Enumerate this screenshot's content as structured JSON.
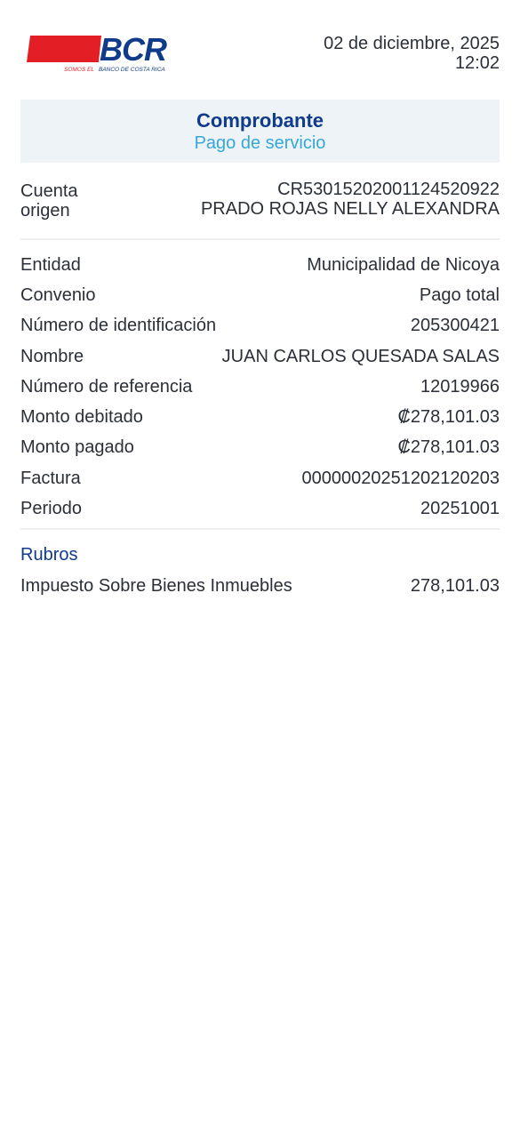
{
  "header": {
    "logo_name": "BCR",
    "logo_tagline": "SOMOS EL BANCO DE COSTA RICA",
    "date": "02 de diciembre, 2025",
    "time": "12:02",
    "brand_red": "#e31e24",
    "brand_blue": "#0f3b8a"
  },
  "banner": {
    "title": "Comprobante",
    "subtitle": "Pago de servicio"
  },
  "origin": {
    "label": "Cuenta origen",
    "account": "CR53015202001124520922",
    "holder": "PRADO ROJAS NELLY ALEXANDRA"
  },
  "details": [
    {
      "label": "Entidad",
      "value": "Municipalidad de Nicoya"
    },
    {
      "label": "Convenio",
      "value": "Pago total"
    },
    {
      "label": "Número de identificación",
      "value": "205300421"
    },
    {
      "label": "Nombre",
      "value": "JUAN CARLOS QUESADA SALAS"
    },
    {
      "label": "Número de referencia",
      "value": "12019966"
    },
    {
      "label": "Monto debitado",
      "value": "₡278,101.03"
    },
    {
      "label": "Monto pagado",
      "value": "₡278,101.03"
    },
    {
      "label": "Factura",
      "value": "000000202512021202​03"
    },
    {
      "label": "Periodo",
      "value": "20251001"
    }
  ],
  "rubros": {
    "title": "Rubros",
    "items": [
      {
        "label": "Impuesto Sobre Bienes Inmuebles",
        "value": "278,101.03"
      }
    ]
  }
}
